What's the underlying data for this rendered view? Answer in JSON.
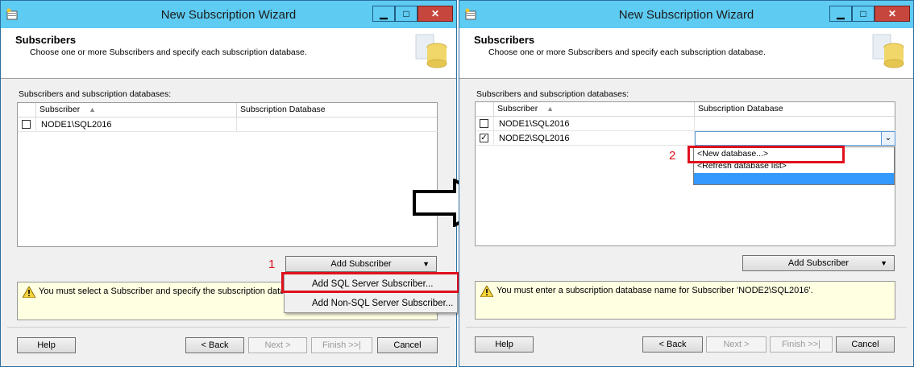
{
  "left": {
    "title": "New Subscription Wizard",
    "header_title": "Subscribers",
    "header_desc": "Choose one or more Subscribers and specify each subscription database.",
    "section_label": "Subscribers and subscription databases:",
    "col_subscriber": "Subscriber",
    "col_database": "Subscription Database",
    "rows": [
      {
        "checked": false,
        "subscriber": "NODE1\\SQL2016",
        "database": ""
      }
    ],
    "add_subscriber_label": "Add Subscriber",
    "menu": [
      "Add SQL Server Subscriber...",
      "Add Non-SQL Server Subscriber..."
    ],
    "message": "You must select a Subscriber and specify the subscription database",
    "step_number": "1",
    "help": "Help",
    "back": "< Back",
    "next": "Next >",
    "finish": "Finish >>|",
    "cancel": "Cancel"
  },
  "right": {
    "title": "New Subscription Wizard",
    "header_title": "Subscribers",
    "header_desc": "Choose one or more Subscribers and specify each subscription database.",
    "section_label": "Subscribers and subscription databases:",
    "col_subscriber": "Subscriber",
    "col_database": "Subscription Database",
    "rows": [
      {
        "checked": false,
        "subscriber": "NODE1\\SQL2016",
        "database": ""
      },
      {
        "checked": true,
        "subscriber": "NODE2\\SQL2016",
        "database": ""
      }
    ],
    "dropdown_options": [
      "<New database...>",
      "<Refresh database list>"
    ],
    "add_subscriber_label": "Add Subscriber",
    "message": "You must enter a subscription database name for Subscriber 'NODE2\\SQL2016'.",
    "step_number": "2",
    "help": "Help",
    "back": "< Back",
    "next": "Next >",
    "finish": "Finish >>|",
    "cancel": "Cancel"
  },
  "colors": {
    "titlebar": "#5ecbf2",
    "close": "#c6463d",
    "highlight": "#e0101d",
    "selection": "#3399ff"
  }
}
